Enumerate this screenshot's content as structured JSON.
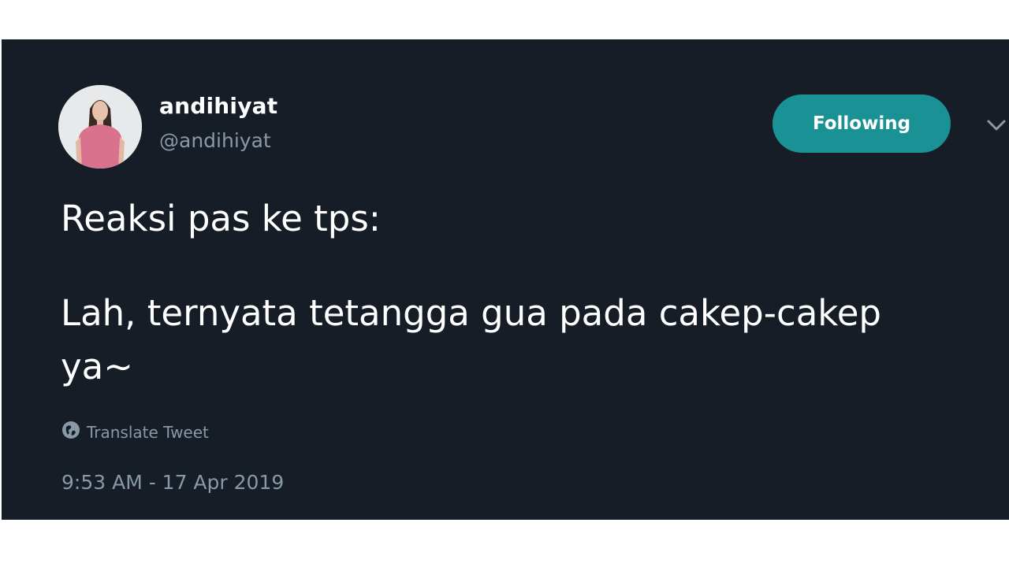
{
  "tweet": {
    "author": {
      "display_name": "andihiyat",
      "handle": "@andihiyat",
      "avatar_icon": "person-avatar"
    },
    "follow_button_label": "Following",
    "menu_icon": "chevron-down-icon",
    "text_lines": [
      "Reaksi pas ke tps:",
      "Lah, ternyata tetangga gua pada cakep-cakep",
      "ya~"
    ],
    "translate_label": "Translate Tweet",
    "translate_icon": "globe-icon",
    "timestamp": "9:53 AM - 17 Apr 2019"
  },
  "colors": {
    "background": "#161d27",
    "accent": "#1a9195",
    "muted_text": "#8899a6",
    "text": "#ffffff"
  }
}
